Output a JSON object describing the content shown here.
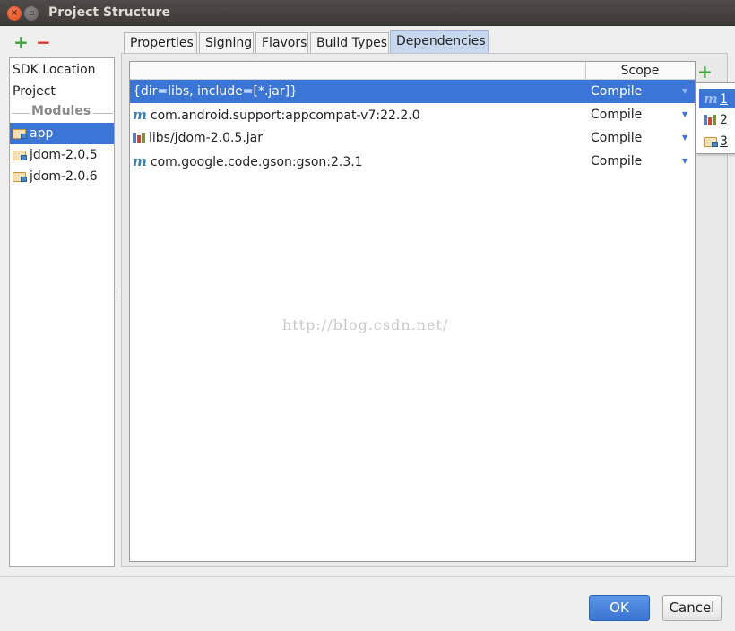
{
  "window": {
    "title": "Project Structure",
    "close_glyph": "×",
    "max_glyph": "▫"
  },
  "left_toolbar": {
    "add": "+",
    "remove": "−"
  },
  "left_panel": {
    "items_top": [
      {
        "label": "SDK Location"
      },
      {
        "label": "Project"
      }
    ],
    "section_label": "Modules",
    "modules": [
      {
        "label": "app",
        "selected": true
      },
      {
        "label": "jdom-2.0.5",
        "selected": false
      },
      {
        "label": "jdom-2.0.6",
        "selected": false
      }
    ]
  },
  "tabs": [
    {
      "label": "Properties"
    },
    {
      "label": "Signing"
    },
    {
      "label": "Flavors"
    },
    {
      "label": "Build Types"
    },
    {
      "label": "Dependencies",
      "active": true
    }
  ],
  "table": {
    "scope_header": "Scope",
    "rows": [
      {
        "icon": "",
        "dependency": "{dir=libs, include=[*.jar]}",
        "scope": "Compile",
        "selected": true
      },
      {
        "icon": "m",
        "dependency": "com.android.support:appcompat-v7:22.2.0",
        "scope": "Compile"
      },
      {
        "icon": "library-icon",
        "dependency": "libs/jdom-2.0.5.jar",
        "scope": "Compile"
      },
      {
        "icon": "m",
        "dependency": "com.google.code.gson:gson:2.3.1",
        "scope": "Compile"
      }
    ],
    "dropdown_glyph": "▼"
  },
  "watermark": "http://blog.csdn.net/",
  "add_dependency": {
    "plus": "+",
    "menu": [
      {
        "icon": "m",
        "label": "1",
        "highlighted": true
      },
      {
        "icon": "library-icon",
        "label": "2"
      },
      {
        "icon": "module-folder-icon",
        "label": "3"
      }
    ]
  },
  "buttons": {
    "ok": "OK",
    "cancel": "Cancel"
  },
  "colors": {
    "selection": "#3b76d6",
    "add_green": "#3aa53a",
    "remove_red": "#d9362b",
    "maven_blue": "#3f7fae"
  }
}
